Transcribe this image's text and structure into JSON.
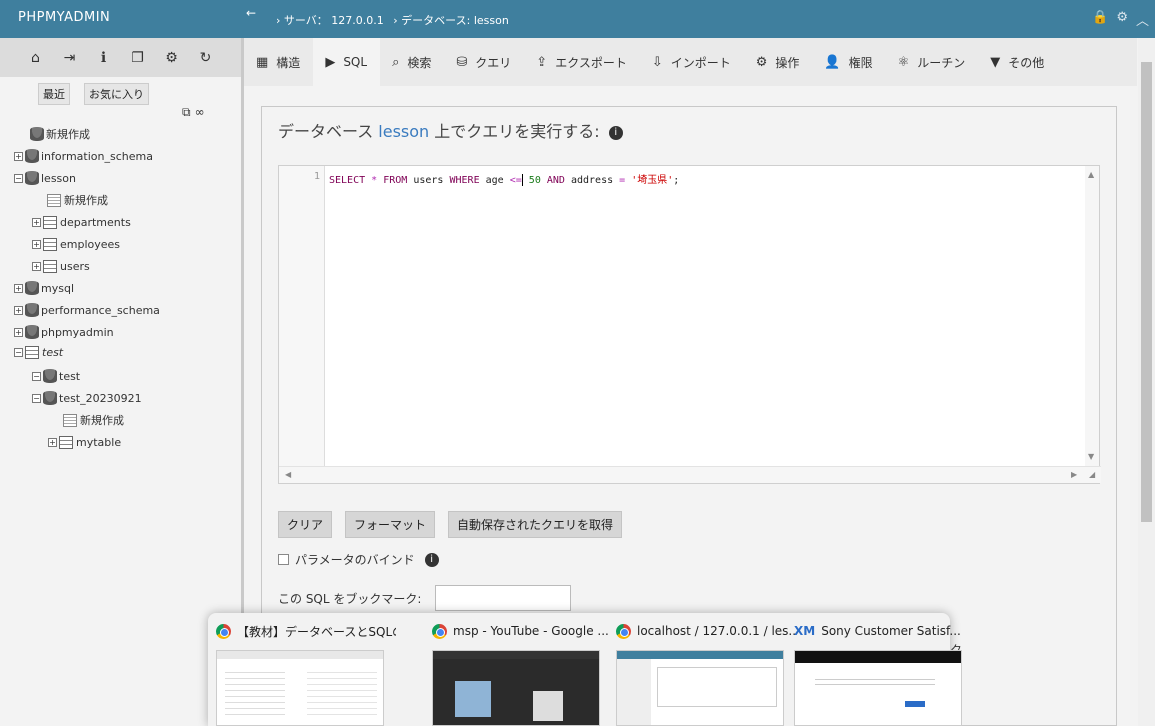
{
  "header": {
    "brand": "PHPMYADMIN",
    "collapse": "←",
    "crumb_server": "›  サーバ： 127.0.0.1",
    "crumb_db": "›  データベース: lesson"
  },
  "nav": {
    "tab_recent": "最近",
    "tab_favorites": "お気に入り",
    "tree": {
      "new1": "新規作成",
      "information_schema": "information_schema",
      "lesson": "lesson",
      "lesson_new": "新規作成",
      "departments": "departments",
      "employees": "employees",
      "users": "users",
      "mysql": "mysql",
      "performance_schema": "performance_schema",
      "phpmyadmin": "phpmyadmin",
      "test_group": "test",
      "test": "test",
      "test_20230921": "test_20230921",
      "test_new": "新規作成",
      "mytable": "mytable"
    }
  },
  "tabs": [
    {
      "label": "構造"
    },
    {
      "label": "SQL"
    },
    {
      "label": "検索"
    },
    {
      "label": "クエリ"
    },
    {
      "label": "エクスポート"
    },
    {
      "label": "インポート"
    },
    {
      "label": "操作"
    },
    {
      "label": "権限"
    },
    {
      "label": "ルーチン"
    },
    {
      "label": "その他"
    }
  ],
  "main": {
    "title_prefix": "データベース",
    "title_db": "lesson",
    "title_suffix": "上でクエリを実行する:",
    "line_no": "1",
    "sql": {
      "kw_select": "SELECT",
      "star": "*",
      "kw_from": "FROM",
      "table": "users",
      "kw_where": "WHERE",
      "col1": "age",
      "op1": "<=",
      "num": "50",
      "kw_and": "AND",
      "col2": "address",
      "op2": "=",
      "str": "'埼玉県'",
      "end": ";"
    },
    "btn_clear": "クリア",
    "btn_format": "フォーマット",
    "btn_autosave": "自動保存されたクエリを取得",
    "bind_label": "パラメータのバインド",
    "bookmark_label": "この SQL をブックマーク:",
    "obscured_text": "ク"
  },
  "taskbar": {
    "items": [
      {
        "title": "【教材】データベースとSQLの基礎を..."
      },
      {
        "title": "msp - YouTube - Google ..."
      },
      {
        "title": "localhost / 127.0.0.1 / les..."
      },
      {
        "title": "Sony Customer Satisf..."
      }
    ],
    "xm_label": "XM"
  }
}
